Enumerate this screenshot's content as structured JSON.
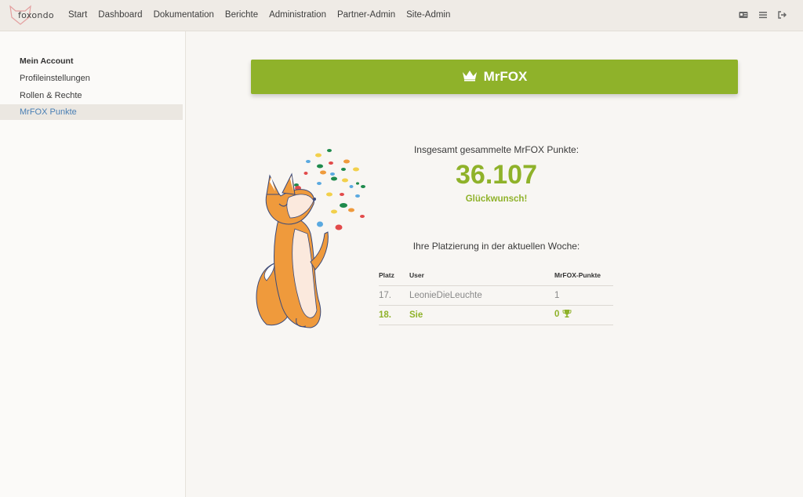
{
  "brand": {
    "logo_text": "foxondo"
  },
  "nav": {
    "items": [
      "Start",
      "Dashboard",
      "Dokumentation",
      "Berichte",
      "Administration",
      "Partner-Admin",
      "Site-Admin"
    ]
  },
  "top_icons": [
    "id-card-icon",
    "list-icon",
    "logout-icon"
  ],
  "sidebar": {
    "title": "Mein Account",
    "items": [
      {
        "label": "Profileinstellungen",
        "active": false
      },
      {
        "label": "Rollen & Rechte",
        "active": false
      },
      {
        "label": "MrFOX Punkte",
        "active": true
      }
    ]
  },
  "banner": {
    "icon": "crown-icon",
    "title": "MrFOX"
  },
  "points": {
    "label": "Insgesamt gesammelte MrFOX Punkte:",
    "value": "36.107",
    "congrats": "Glückwunsch!"
  },
  "ranking": {
    "label": "Ihre Platzierung in der aktuellen Woche:",
    "headers": {
      "rank": "Platz",
      "user": "User",
      "points": "MrFOX-Punkte"
    },
    "rows": [
      {
        "rank": "17.",
        "user": "LeonieDieLeuchte",
        "points": "1",
        "me": false
      },
      {
        "rank": "18.",
        "user": "Sie",
        "points": "0",
        "me": true,
        "icon": "trophy-icon"
      }
    ]
  },
  "colors": {
    "accent": "#8fb22a",
    "link": "#4a7fb4",
    "fox": "#ef9a3c"
  }
}
